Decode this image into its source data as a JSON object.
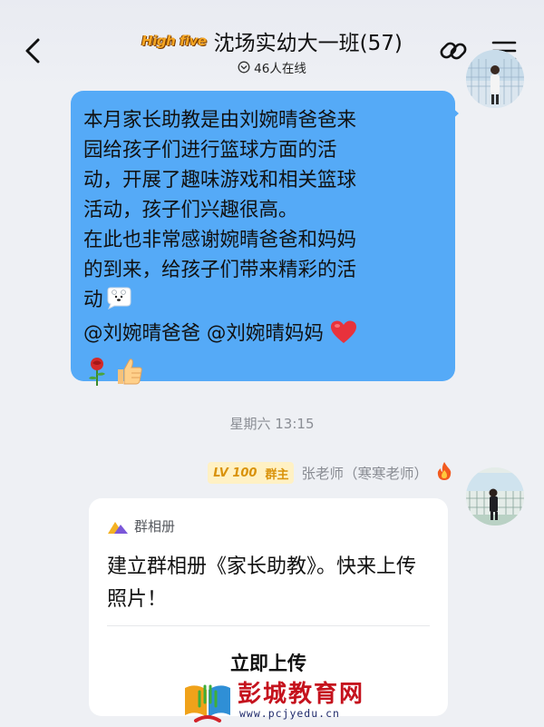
{
  "header": {
    "logo_text": "High five",
    "title": "沈场实幼大一班(57)",
    "online": "46人在线",
    "back_icon": "chevron-left-icon",
    "link_icon": "chain-link-icon",
    "menu_icon": "hamburger-menu-icon"
  },
  "message_sent": {
    "lines": [
      "本月家长助教是由刘婉晴爸爸来",
      "园给孩子们进行篮球方面的活",
      "动，开展了趣味游戏和相关篮球",
      "活动，孩子们兴趣很高。",
      "在此也非常感谢婉晴爸爸和妈妈",
      "的到来，给孩子们带来精彩的活"
    ],
    "line_7_text": "动",
    "line_8_text": "@刘婉晴爸爸 @刘婉晴妈妈",
    "emojis": [
      "polar-bear-emoji",
      "red-heart-emoji",
      "rose-emoji",
      "thumbs-up-emoji"
    ],
    "bubble_color": "#55aaf7"
  },
  "timestamp": "星期六 13:15",
  "sender": {
    "level": "LV 100",
    "role": "群主",
    "name": "张老师（寒寒老师）",
    "badge_icon": "fire-icon"
  },
  "card": {
    "source": "群相册",
    "source_icon": "album-mountain-icon",
    "body": "建立群相册《家长助教》。快来上传照片！",
    "action": "立即上传"
  },
  "watermark": {
    "name": "彭城教育网",
    "url": "www.pcjyedu.cn"
  },
  "colors": {
    "accent_blue": "#55aaf7",
    "badge_gold": "#d9920a",
    "watermark_red": "#c5121d"
  }
}
